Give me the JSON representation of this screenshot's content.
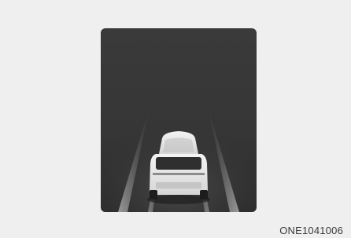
{
  "figure": {
    "code": "ONE1041006",
    "scene": "rear-view-of-vehicle-ahead-on-dark-road",
    "colors": {
      "background": "#efefef",
      "display": "#3c3c3c",
      "lane": "#8a8a8a",
      "vehicle": "#e6e6e6"
    }
  }
}
